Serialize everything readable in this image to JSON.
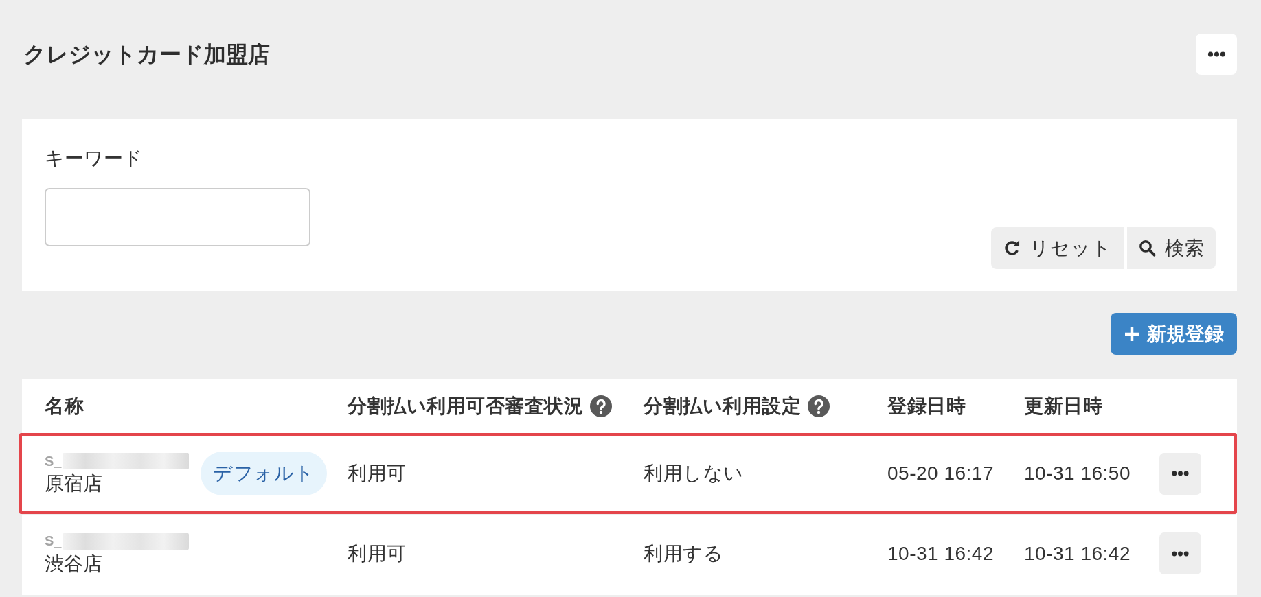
{
  "page": {
    "title": "クレジットカード加盟店"
  },
  "search": {
    "label": "キーワード",
    "buttons": [
      {
        "kind": "reset",
        "label": "リセット"
      },
      {
        "kind": "search",
        "label": "検索"
      }
    ]
  },
  "new_button": {
    "label": "新規登録"
  },
  "table": {
    "columns": [
      {
        "label": "名称",
        "help": false
      },
      {
        "label": "分割払い利用可否審査状況",
        "help": true
      },
      {
        "label": "分割払い利用設定",
        "help": true
      },
      {
        "label": "登録日時",
        "help": false
      },
      {
        "label": "更新日時",
        "help": false
      }
    ],
    "rows": [
      {
        "highlighted": true,
        "cells": [
          {
            "code": "S_",
            "code_redacted": true,
            "text": "原宿店",
            "badge": "デフォルト"
          },
          {
            "text": "利用可"
          },
          {
            "text": "利用しない"
          },
          {
            "text": "05-20 16:17"
          },
          {
            "text": "10-31 16:50"
          }
        ]
      },
      {
        "highlighted": false,
        "cells": [
          {
            "code": "S_",
            "code_redacted": true,
            "text": "渋谷店"
          },
          {
            "text": "利用可"
          },
          {
            "text": "利用する"
          },
          {
            "text": "10-31 16:42"
          },
          {
            "text": "10-31 16:42"
          }
        ]
      }
    ]
  }
}
